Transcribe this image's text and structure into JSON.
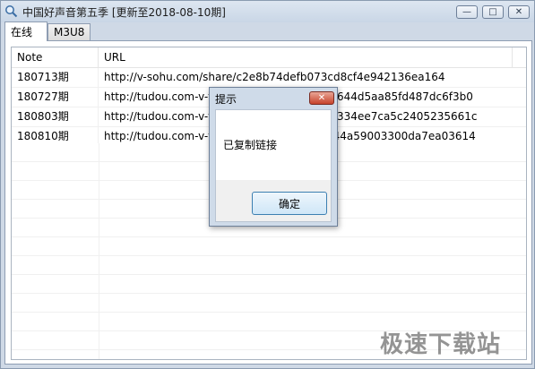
{
  "window": {
    "title": "中国好声音第五季 [更新至2018-08-10期]",
    "minimize_glyph": "—",
    "maximize_glyph": "□",
    "close_glyph": "✕"
  },
  "tabs": [
    {
      "label": "在线",
      "active": true
    },
    {
      "label": "M3U8",
      "active": false
    }
  ],
  "list": {
    "columns": [
      "Note",
      "URL"
    ],
    "rows": [
      {
        "note": "180713期",
        "url": "http://v-sohu.com/share/c2e8b74defb073cd8cf4e942136ea164"
      },
      {
        "note": "180727期",
        "url": "http://tudou.com-v-tudou.com/share/d0320644d5aa85fd487dc6f3b0"
      },
      {
        "note": "180803期",
        "url": "http://tudou.com-v-tudou.com/share/09288334ee7ca5c2405235661c"
      },
      {
        "note": "180810期",
        "url": "http://tudou.com-v-tudou.com/share/7f3c344a59003300da7ea03614"
      }
    ]
  },
  "dialog": {
    "title": "提示",
    "message": "已复制链接",
    "ok_label": "确定",
    "close_glyph": "✕"
  },
  "watermark": {
    "text": "极速下载站"
  }
}
